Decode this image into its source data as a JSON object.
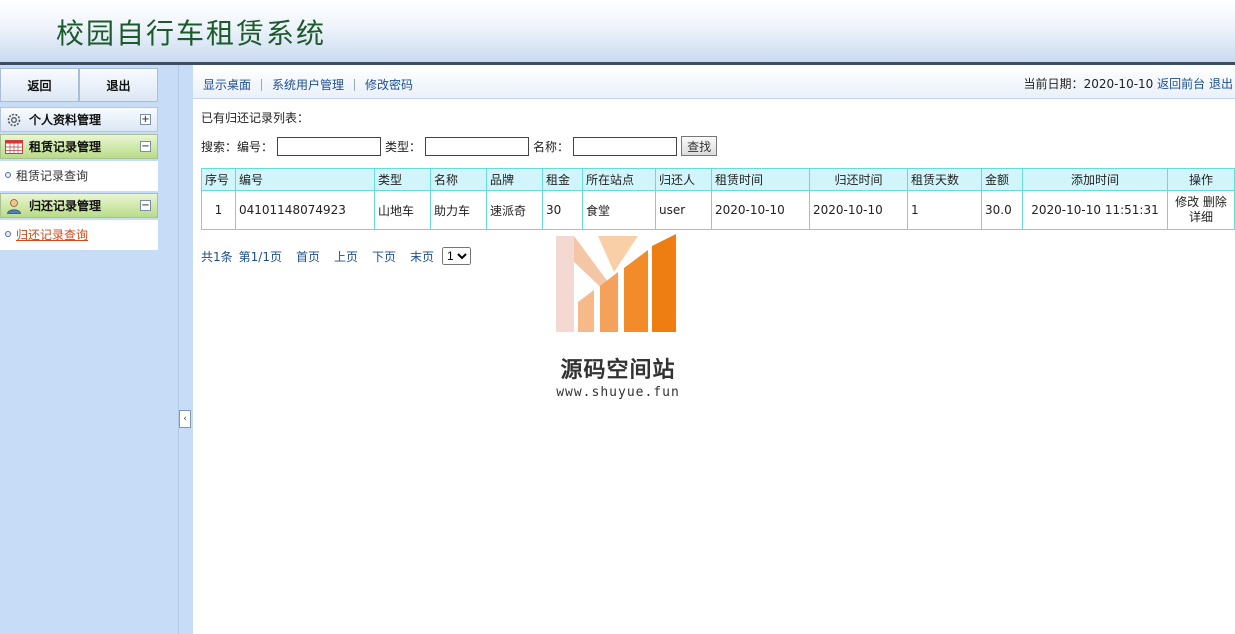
{
  "app": {
    "title": "校园自行车租赁系统"
  },
  "sidebar": {
    "back_label": "返回",
    "logout_label": "退出",
    "groups": [
      {
        "label": "个人资料管理",
        "toggle": "+",
        "items": []
      },
      {
        "label": "租赁记录管理",
        "toggle": "−",
        "items": [
          {
            "label": "租赁记录查询"
          }
        ]
      },
      {
        "label": "归还记录管理",
        "toggle": "−",
        "items": [
          {
            "label": "归还记录查询"
          }
        ]
      }
    ],
    "collapse_glyph": "‹"
  },
  "topnav": {
    "links": [
      "显示桌面",
      "系统用户管理",
      "修改密码"
    ],
    "date_label": "当前日期：",
    "date_value": "2020-10-10",
    "back_front": "返回前台",
    "logout": "退出"
  },
  "list": {
    "title": "已有归还记录列表："
  },
  "search": {
    "prefix": "搜索：",
    "code_label": "编号：",
    "type_label": "类型：",
    "name_label": "名称：",
    "code_value": "",
    "type_value": "",
    "name_value": "",
    "button": "查找"
  },
  "table": {
    "headers": [
      "序号",
      "编号",
      "类型",
      "名称",
      "品牌",
      "租金",
      "所在站点",
      "归还人",
      "租赁时间",
      "归还时间",
      "租赁天数",
      "金额",
      "添加时间",
      "操作"
    ],
    "rows": [
      {
        "index": "1",
        "code": "04101148074923",
        "type": "山地车",
        "name": "助力车",
        "brand": "速派奇",
        "rent": "30",
        "station": "食堂",
        "returner": "user",
        "rent_time": "2020-10-10",
        "return_time": "2020-10-10",
        "days": "1",
        "amount": "30.0",
        "added": "2020-10-10 11:51:31",
        "op_edit": "修改",
        "op_delete": "删除",
        "op_detail": "详细"
      }
    ]
  },
  "pager": {
    "total": "共1条",
    "page": "第1/1页",
    "first": "首页",
    "prev": "上页",
    "next": "下页",
    "last": "末页",
    "selected": "1"
  },
  "watermark": {
    "name": "源码空间站",
    "url": "www.shuyue.fun"
  }
}
